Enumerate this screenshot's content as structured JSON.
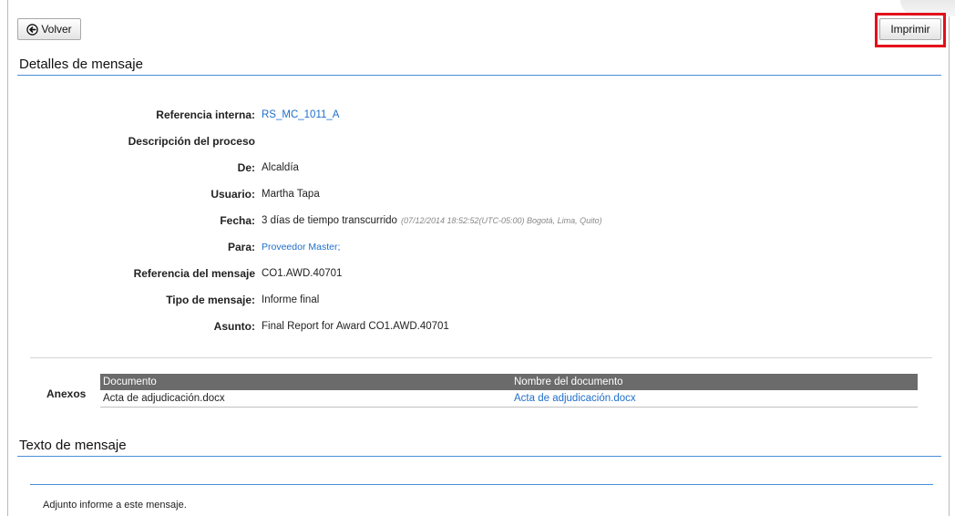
{
  "toolbar": {
    "back_label": "Volver",
    "print_label": "Imprimir"
  },
  "details": {
    "title": "Detalles de mensaje",
    "fields": [
      {
        "label": "Referencia interna:",
        "value": "RS_MC_1011_A",
        "link": true
      },
      {
        "label": "Descripción del proceso",
        "value": ""
      },
      {
        "label": "De:",
        "value": "Alcaldía"
      },
      {
        "label": "Usuario:",
        "value": "Martha Tapa"
      },
      {
        "label": "Fecha:",
        "value": "3 días de tiempo transcurrido",
        "note": "(07/12/2014 18:52:52(UTC-05:00) Bogotá, Lima, Quito)"
      },
      {
        "label": "Para:",
        "value": "Proveedor Master;",
        "link": true
      },
      {
        "label": "Referencia del mensaje",
        "value": "CO1.AWD.40701"
      },
      {
        "label": "Tipo de mensaje:",
        "value": "Informe final"
      },
      {
        "label": "Asunto:",
        "value": "Final Report for Award CO1.AWD.40701"
      }
    ]
  },
  "attachments": {
    "label": "Anexos",
    "columns": [
      "Documento",
      "Nombre del documento"
    ],
    "rows": [
      {
        "document": "Acta de adjudicación.docx",
        "name": "Acta de adjudicación.docx"
      }
    ]
  },
  "message": {
    "title": "Texto de mensaje",
    "body": "Adjunto informe a este mensaje."
  },
  "colors": {
    "accent": "#4a8fd9",
    "link": "#1f6fc9",
    "highlight": "#e3101a",
    "table_header": "#6b6b6b"
  }
}
